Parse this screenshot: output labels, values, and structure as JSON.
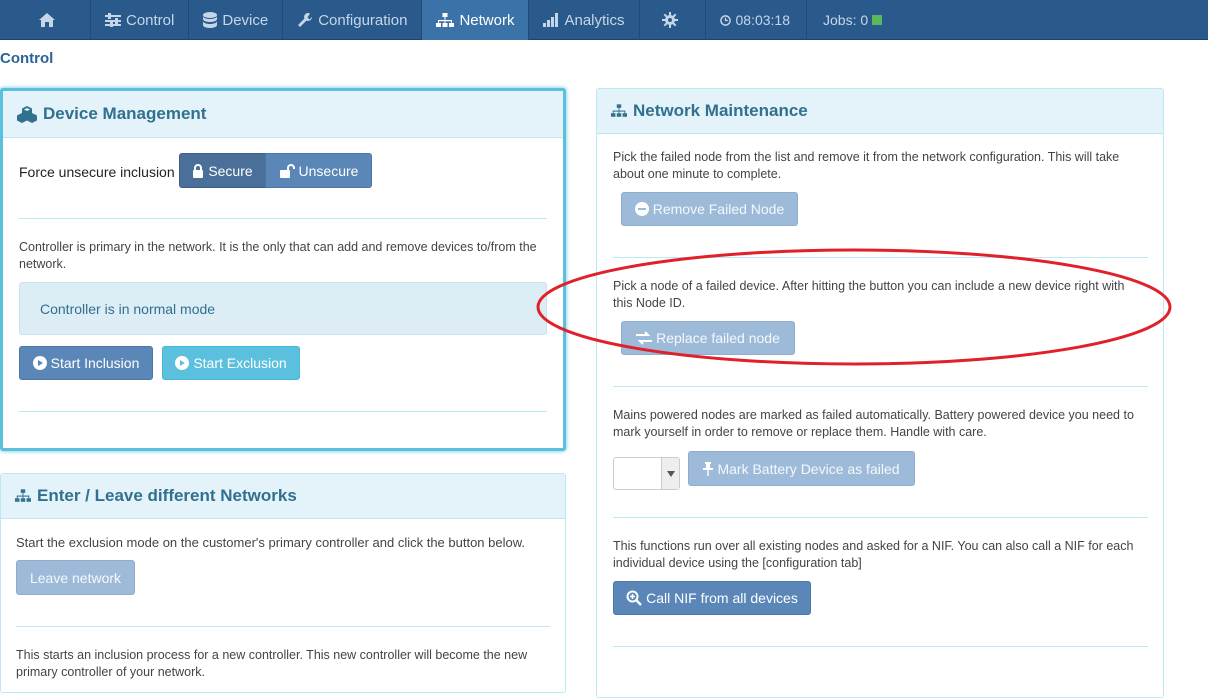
{
  "nav": {
    "home_icon": "home-icon",
    "items": [
      {
        "label": "Control",
        "icon": "sliders-icon"
      },
      {
        "label": "Device",
        "icon": "database-icon"
      },
      {
        "label": "Configuration",
        "icon": "wrench-icon"
      },
      {
        "label": "Network",
        "icon": "sitemap-icon",
        "active": true
      },
      {
        "label": "Analytics",
        "icon": "bars-icon"
      }
    ],
    "settings_icon": "gear-icon",
    "time": "08:03:18",
    "jobs_label": "Jobs: 0"
  },
  "page": {
    "title": "Control"
  },
  "device_management": {
    "title": "Device Management",
    "force_label": "Force unsecure inclusion",
    "secure_label": "Secure",
    "unsecure_label": "Unsecure",
    "description": "Controller is primary in the network. It is the only that can add and remove devices to/from the network.",
    "status": "Controller is in normal mode",
    "start_inclusion": "Start Inclusion",
    "start_exclusion": "Start Exclusion"
  },
  "enter_leave": {
    "title": "Enter / Leave different Networks",
    "exclusion_text": "Start the exclusion mode on the customer's primary controller and click the button below.",
    "leave_button": "Leave network",
    "inclusion_text": "This starts an inclusion process for a new controller. This new controller will become the new primary controller of your network."
  },
  "network_maintenance": {
    "title": "Network Maintenance",
    "remove_text": "Pick the failed node from the list and remove it from the network configuration. This will take about one minute to complete.",
    "remove_button": "Remove Failed Node",
    "replace_text": "Pick a node of a failed device. After hitting the button you can include a new device right with this Node ID.",
    "replace_button": "Replace failed node",
    "mains_text": "Mains powered nodes are marked as failed automatically. Battery powered device you need to mark yourself in order to remove or replace them. Handle with care.",
    "node_select_value": "",
    "mark_button": "Mark Battery Device as failed",
    "nif_text": "This functions run over all existing nodes and asked for a NIF. You can also call a NIF for each individual device using the [configuration tab]",
    "nif_button": "Call NIF from all devices"
  },
  "colors": {
    "navbar": "#2a5a8c",
    "active_tab": "#3b72a8",
    "panel_heading": "#e3f3f9",
    "annotation": "#e0202a"
  }
}
